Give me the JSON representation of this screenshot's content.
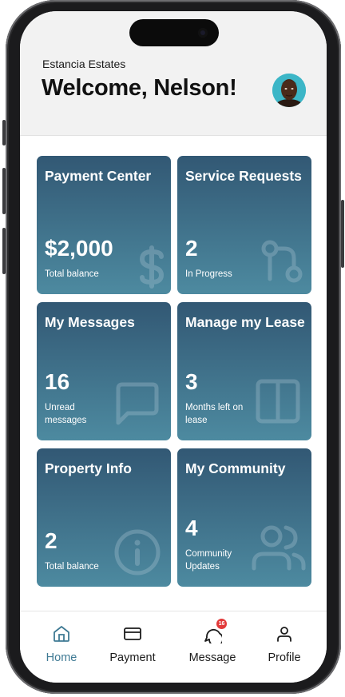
{
  "header": {
    "property_name": "Estancia Estates",
    "welcome": "Welcome, Nelson!"
  },
  "cards": [
    {
      "title": "Payment Center",
      "value": "$2,000",
      "subtitle": "Total balance",
      "icon": "dollar-icon"
    },
    {
      "title": "Service Requests",
      "value": "2",
      "subtitle": "In Progress",
      "icon": "pull-request-icon"
    },
    {
      "title": "My Messages",
      "value": "16",
      "subtitle": "Unread messages",
      "icon": "message-square-icon"
    },
    {
      "title": "Manage my Lease",
      "value": "3",
      "subtitle": "Months left on lease",
      "icon": "columns-icon"
    },
    {
      "title": "Property Info",
      "value": "2",
      "subtitle": "Total balance",
      "icon": "info-icon"
    },
    {
      "title": "My Community",
      "value": "4",
      "subtitle": "Community Updates",
      "icon": "users-icon"
    }
  ],
  "tabbar": {
    "tabs": [
      {
        "label": "Home",
        "icon": "home-icon",
        "active": true
      },
      {
        "label": "Payment",
        "icon": "credit-card-icon"
      },
      {
        "label": "Message",
        "icon": "message-circle-icon",
        "badge": "16"
      },
      {
        "label": "Profile",
        "icon": "user-icon"
      }
    ]
  },
  "colors": {
    "card_top": "#325874",
    "card_bottom": "#4d8aa0",
    "accent": "#3f7a94",
    "badge": "#e23a3a"
  }
}
